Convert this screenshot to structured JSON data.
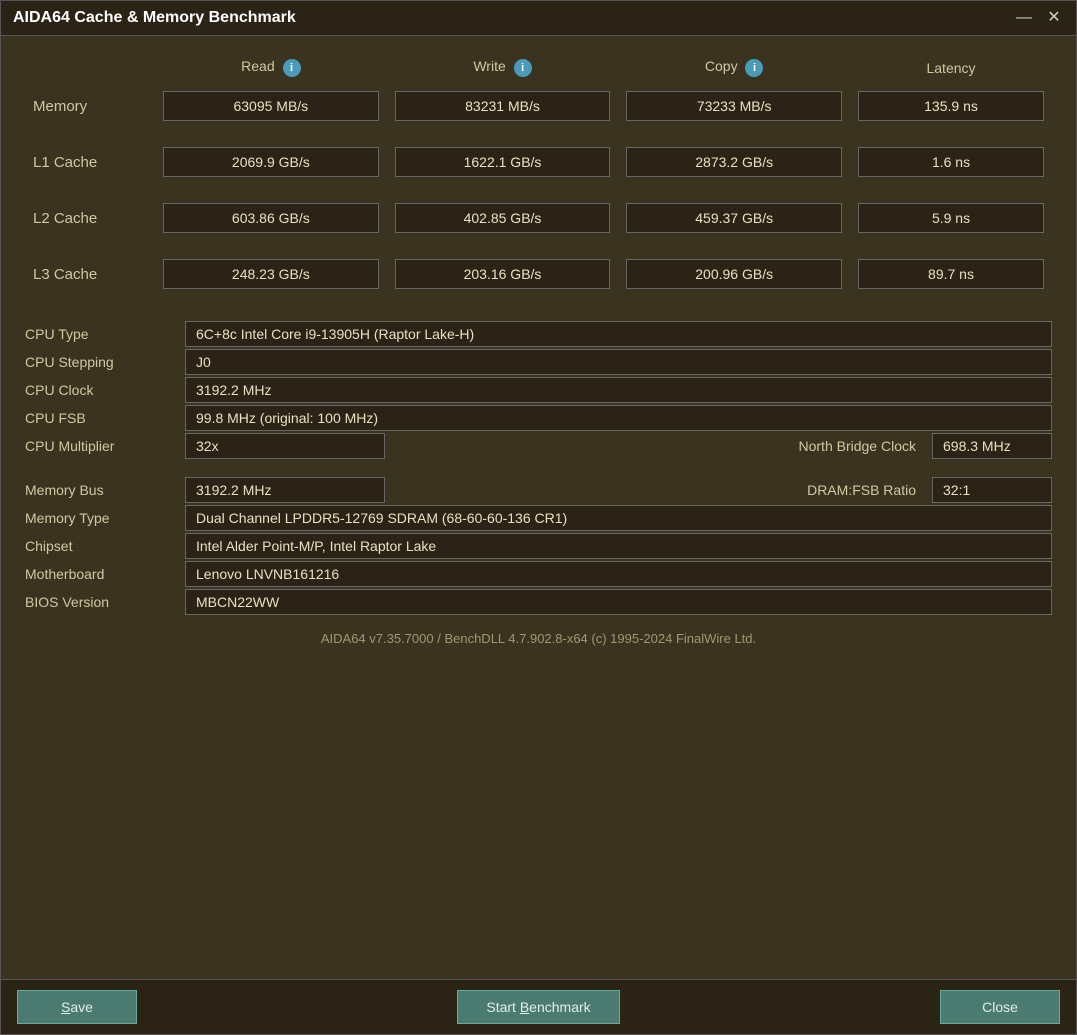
{
  "window": {
    "title": "AIDA64 Cache & Memory Benchmark",
    "minimize_btn": "—",
    "close_btn": "✕"
  },
  "headers": {
    "read": "Read",
    "write": "Write",
    "copy": "Copy",
    "latency": "Latency"
  },
  "rows": [
    {
      "label": "Memory",
      "read": "63095 MB/s",
      "write": "83231 MB/s",
      "copy": "73233 MB/s",
      "latency": "135.9 ns"
    },
    {
      "label": "L1 Cache",
      "read": "2069.9 GB/s",
      "write": "1622.1 GB/s",
      "copy": "2873.2 GB/s",
      "latency": "1.6 ns"
    },
    {
      "label": "L2 Cache",
      "read": "603.86 GB/s",
      "write": "402.85 GB/s",
      "copy": "459.37 GB/s",
      "latency": "5.9 ns"
    },
    {
      "label": "L3 Cache",
      "read": "248.23 GB/s",
      "write": "203.16 GB/s",
      "copy": "200.96 GB/s",
      "latency": "89.7 ns"
    }
  ],
  "cpu_info": {
    "cpu_type_label": "CPU Type",
    "cpu_type_value": "6C+8c Intel Core i9-13905H  (Raptor Lake-H)",
    "cpu_stepping_label": "CPU Stepping",
    "cpu_stepping_value": "J0",
    "cpu_clock_label": "CPU Clock",
    "cpu_clock_value": "3192.2 MHz",
    "cpu_fsb_label": "CPU FSB",
    "cpu_fsb_value": "99.8 MHz  (original: 100 MHz)",
    "cpu_multiplier_label": "CPU Multiplier",
    "cpu_multiplier_value": "32x",
    "north_bridge_label": "North Bridge Clock",
    "north_bridge_value": "698.3 MHz"
  },
  "memory_info": {
    "memory_bus_label": "Memory Bus",
    "memory_bus_value": "3192.2 MHz",
    "dram_fsb_label": "DRAM:FSB Ratio",
    "dram_fsb_value": "32:1",
    "memory_type_label": "Memory Type",
    "memory_type_value": "Dual Channel LPDDR5-12769 SDRAM  (68-60-60-136 CR1)",
    "chipset_label": "Chipset",
    "chipset_value": "Intel Alder Point-M/P, Intel Raptor Lake",
    "motherboard_label": "Motherboard",
    "motherboard_value": "Lenovo LNVNB161216",
    "bios_label": "BIOS Version",
    "bios_value": "MBCN22WW"
  },
  "footer": {
    "text": "AIDA64 v7.35.7000 / BenchDLL 4.7.902.8-x64  (c) 1995-2024 FinalWire Ltd."
  },
  "buttons": {
    "save": "Save",
    "save_underline": "S",
    "start_benchmark": "Start Benchmark",
    "start_underline": "B",
    "close": "Close"
  }
}
